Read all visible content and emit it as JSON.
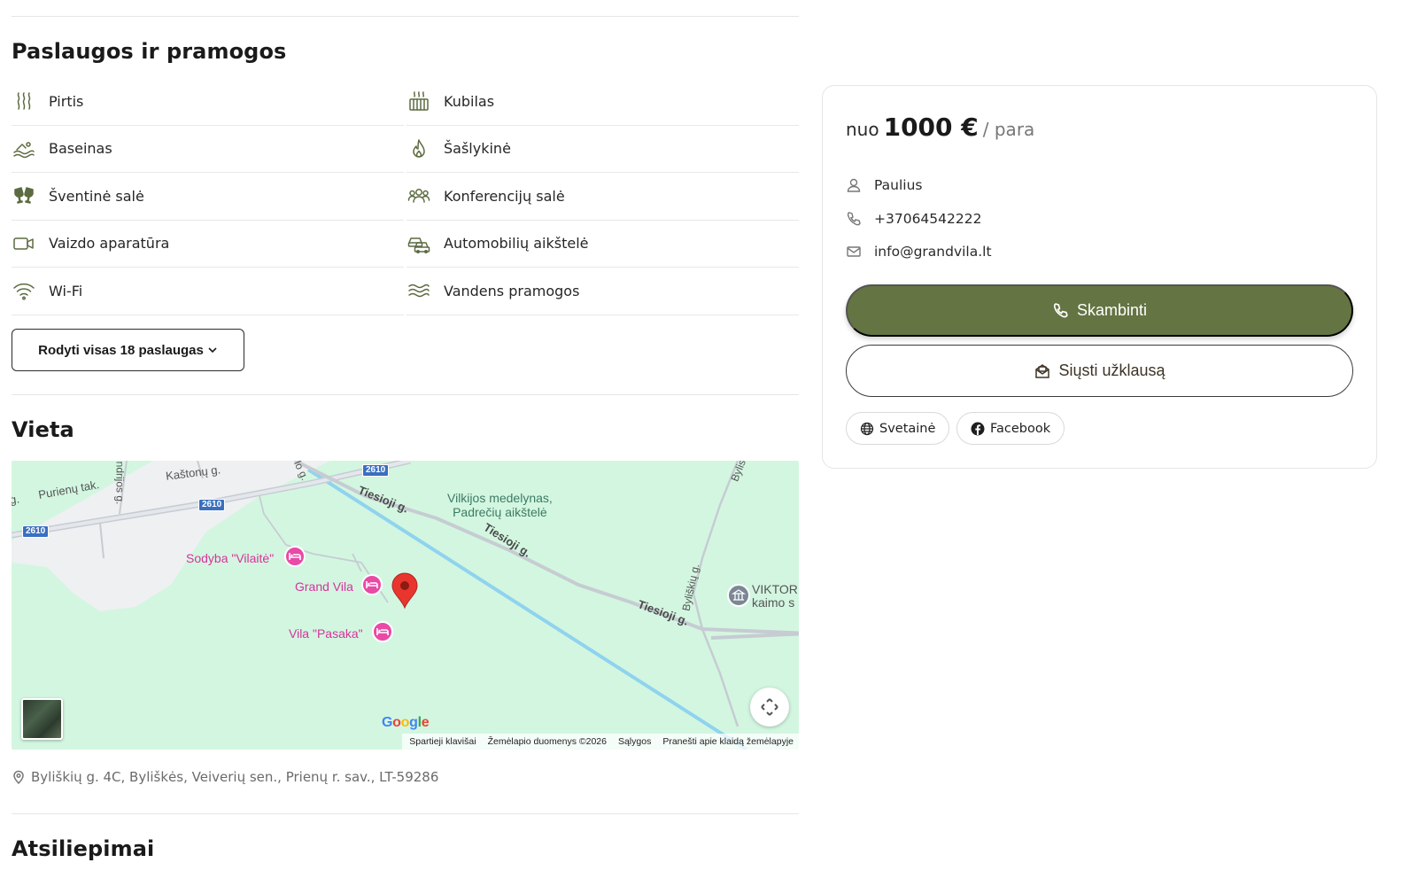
{
  "amenities": {
    "title": "Paslaugos ir pramogos",
    "items": [
      {
        "label": "Pirtis",
        "icon": "steam-icon"
      },
      {
        "label": "Kubilas",
        "icon": "hot-tub-icon"
      },
      {
        "label": "Baseinas",
        "icon": "pool-icon"
      },
      {
        "label": "Šašlykinė",
        "icon": "fire-icon"
      },
      {
        "label": "Šventinė salė",
        "icon": "celebration-glasses-icon"
      },
      {
        "label": "Konferencijų salė",
        "icon": "people-group-icon"
      },
      {
        "label": "Vaizdo aparatūra",
        "icon": "video-camera-icon"
      },
      {
        "label": "Automobilių aikštelė",
        "icon": "parking-cars-icon"
      },
      {
        "label": "Wi-Fi",
        "icon": "wifi-icon"
      },
      {
        "label": "Vandens pramogos",
        "icon": "waves-icon"
      }
    ],
    "show_all_label": "Rodyti visas 18 paslaugas"
  },
  "location": {
    "title": "Vieta",
    "address": "Byliškių g. 4C, Byliškės, Veiverių sen., Prienų r. sav., LT-59286",
    "map": {
      "roads": {
        "g_left": "g.",
        "puriena": "Purienų tak.",
        "kastonu": "Kaštonų g.",
        "ndrijos": "ndrijos g.",
        "lo": "lo g.",
        "tiesioji1": "Tiesioji g.",
        "tiesioji2": "Tiesioji g.",
        "tiesioji3": "Tiesioji g.",
        "byliskiu": "Byliškių g.",
        "bylis": "Bylis"
      },
      "highway_badges": [
        "2610",
        "2610",
        "2610"
      ],
      "places": {
        "vilkijos_line1": "Vilkijos medelynas,",
        "vilkijos_line2": "Padrečių aikštelė",
        "viktor_line1": "VIKTOR",
        "viktor_line2": "kaimo s"
      },
      "pois": {
        "vilaite": "Sodyba \"Vilaitė\"",
        "grand_vila": "Grand Vila",
        "pasaka": "Vila \"Pasaka\""
      },
      "google": "Google",
      "attribution": [
        "Spartieji klavišai",
        "Žemėlapio duomenys ©2026",
        "Sąlygos",
        "Pranešti apie klaidą žemėlapyje"
      ]
    }
  },
  "reviews": {
    "title": "Atsiliepimai"
  },
  "sidebar": {
    "price_prefix": "nuo",
    "price_amount": "1000 €",
    "price_suffix": "/ para",
    "contact_name": "Paulius",
    "phone": "+37064542222",
    "email": "info@grandvila.lt",
    "call_label": "Skambinti",
    "inquiry_label": "Siųsti užklausą",
    "website_label": "Svetainė",
    "facebook_label": "Facebook"
  },
  "colors": {
    "accent": "#647442",
    "icon": "#5c6b40",
    "map_bg": "#d3f6e1",
    "poi": "#d6339a"
  }
}
